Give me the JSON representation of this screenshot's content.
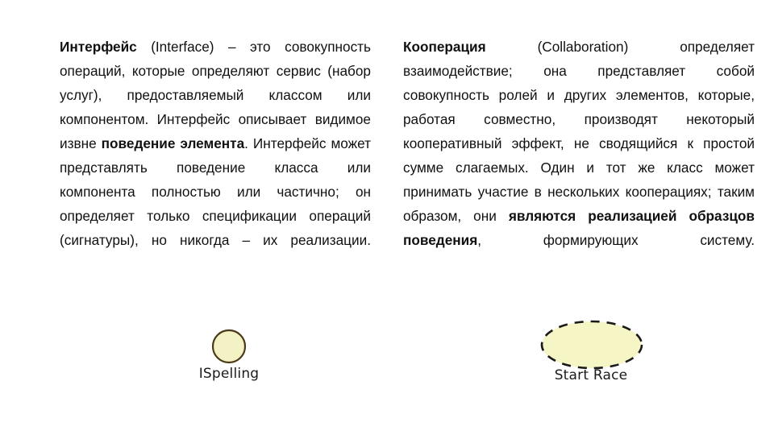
{
  "slide": {
    "background_color": "#ffffff",
    "text_color": "#111111"
  },
  "left_column": {
    "term": "Интерфейс",
    "term_english": "(Interface)",
    "body_before_emphasis": " – это совокупность операций, которые определяют сервис (набор услуг), предоставляемый классом или компонентом. Интерфейс описывает видимое извне ",
    "emphasis": "поведение элемента",
    "body_after_emphasis": ". Интерфейс может представлять поведение класса или компонента полностью или частично; он определяет только спецификации операций (сигнатуры), но никогда – их реализации.",
    "full_text": "Интерфейс (Interface) – это совокупность операций, которые определяют сервис (набор услуг), предоставляемый классом или компонентом. Интерфейс описывает видимое извне поведение элемента. Интерфейс может представлять поведение класса или компонента полностью или частично; он определяет только спецификации операций (сигнатуры), но никогда – их реализации."
  },
  "right_column": {
    "term": "Кооперация",
    "term_english": "(Collaboration)",
    "body_before_emphasis": " определяет взаимодействие; она представляет собой совокупность ролей и других элементов, которые, работая совместно, производят некоторый кооперативный эффект, не сводящийся к простой сумме слагаемых. Один и тот же класс может принимать участие в нескольких кооперациях; таким образом, они ",
    "emphasis": "являются реализацией образцов поведения",
    "body_after_emphasis": ", формирующих систему.",
    "full_text": "Кооперация (Collaboration) определяет взаимодействие; она представляет собой совокупность ролей и других элементов, которые, работая совместно, производят некоторый кооперативный эффект, не сводящийся к простой сумме слагаемых. Один и тот же класс может принимать участие в нескольких кооперациях; таким образом, они являются реализацией образцов поведения, формирующих систему."
  },
  "figures": {
    "interface_figure": {
      "shape": "circle",
      "shape_name": "interface-circle-icon",
      "caption": "ISpelling",
      "fill_color": "#f2f2c4",
      "stroke_color": "#4a3a18",
      "stroke_style": "solid",
      "background_color": "#ffffff"
    },
    "collaboration_figure": {
      "shape": "ellipse",
      "shape_name": "collaboration-ellipse-icon",
      "caption": "Start Race",
      "fill_color": "#f5f5c6",
      "stroke_color": "#1a1a1a",
      "stroke_style": "dashed",
      "background_color": "#ffffff"
    }
  }
}
